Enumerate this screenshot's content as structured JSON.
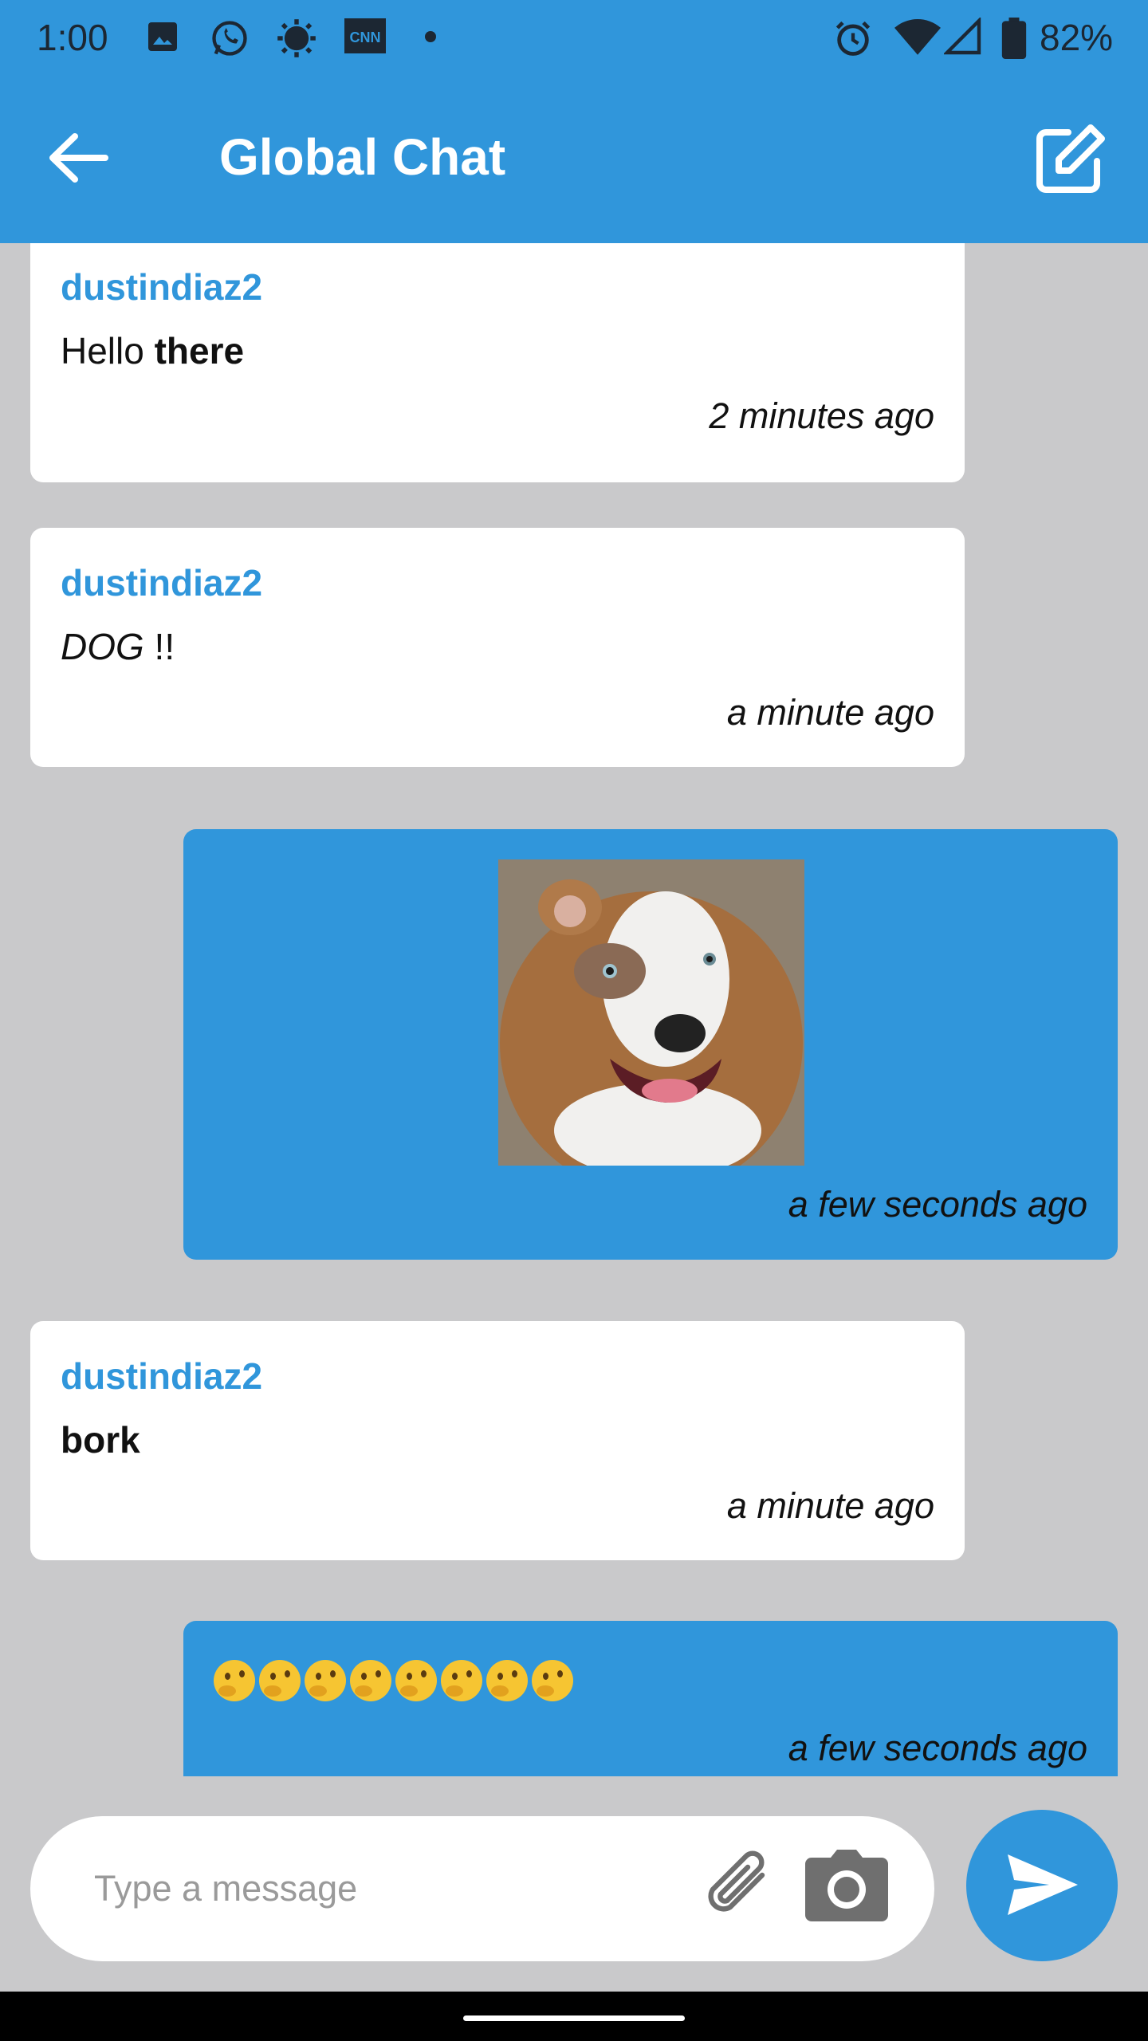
{
  "status_bar": {
    "time": "1:00",
    "battery": "82%",
    "notification_icons": [
      "image-icon",
      "whatsapp-icon",
      "settings-sun-icon",
      "cnn-icon",
      "dot-icon"
    ],
    "system_icons": [
      "alarm-icon",
      "wifi-icon",
      "signal-icon",
      "battery-icon"
    ]
  },
  "app_bar": {
    "title": "Global Chat",
    "back_icon": "arrow-left-icon",
    "compose_icon": "edit-icon"
  },
  "messages": [
    {
      "user": "dustindiaz2",
      "text_plain": "Hello ",
      "text_bold": "there",
      "time": "2 minutes ago",
      "incoming": true
    },
    {
      "user": "dustindiaz2",
      "text_italic": "DOG",
      "text_plain": " !!",
      "time": "a minute ago",
      "incoming": true
    },
    {
      "image": "dog-photo",
      "time": "a few seconds ago",
      "incoming": false
    },
    {
      "user": "dustindiaz2",
      "text_bold": "bork",
      "time": "a minute ago",
      "incoming": true
    },
    {
      "emoji": "thinking-face",
      "emoji_count": 8,
      "time": "a few seconds ago",
      "incoming": false
    }
  ],
  "composer": {
    "placeholder": "Type a message",
    "attach_icon": "paperclip-icon",
    "camera_icon": "camera-icon",
    "send_icon": "send-icon"
  },
  "colors": {
    "accent": "#3096db",
    "background": "#c9c9cb",
    "bubble_in": "#ffffff"
  }
}
